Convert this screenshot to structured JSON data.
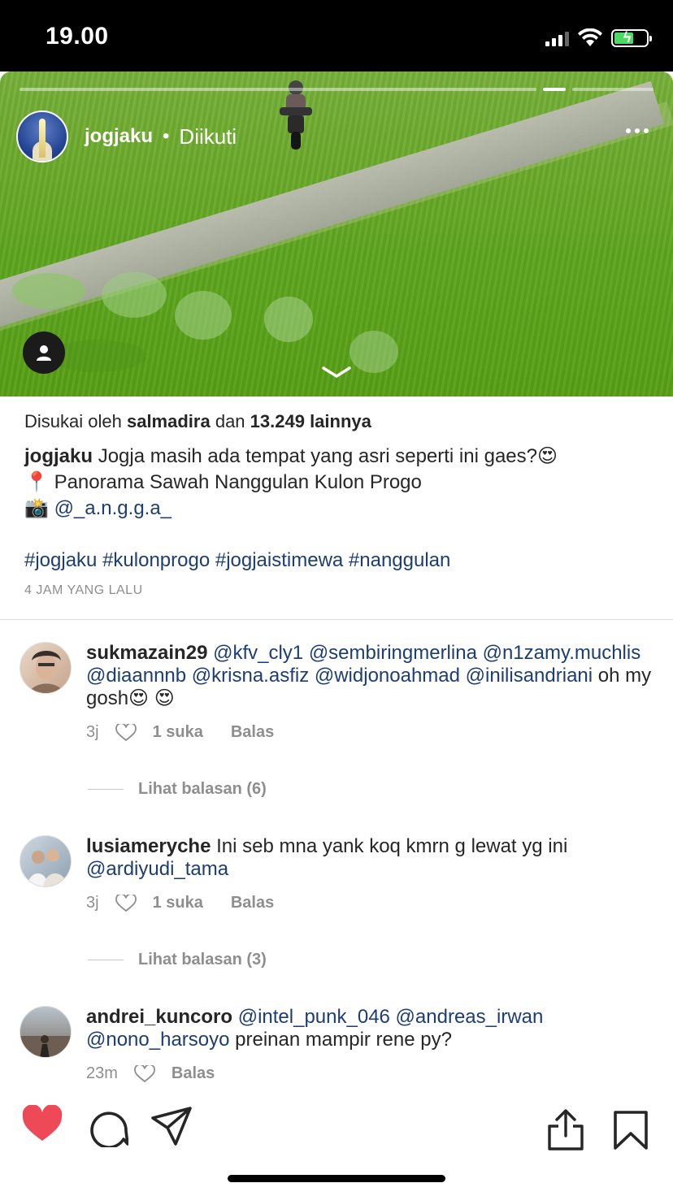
{
  "status_bar": {
    "time": "19.00",
    "signal_icon": "signal-bars-icon",
    "wifi_icon": "wifi-icon",
    "battery_icon": "battery-charging-icon",
    "battery_color": "#4cd964"
  },
  "post": {
    "username": "jogjaku",
    "separator": "•",
    "follow_status": "Diikuti",
    "more_icon": "more-dots-icon",
    "tag_icon": "person-tag-icon",
    "collapse_icon": "chevron-down-icon"
  },
  "likes": {
    "prefix": "Disukai oleh",
    "user": "salmadira",
    "connector": "dan",
    "count": "13.249 lainnya"
  },
  "caption": {
    "username": "jogjaku",
    "line1": "Jogja masih ada tempat yang asri seperti ini gaes?",
    "line1_emoji": "😍",
    "pin_emoji": "📍",
    "line2": "Panorama Sawah Nanggulan Kulon Progo",
    "camera_emoji": "📸",
    "line3_mention": "@_a.n.g.g.a_",
    "hashtags": "#jogjaku #kulonprogo #jogjaistimewa #nanggulan",
    "time_ago": "4 JAM YANG LALU"
  },
  "comments": [
    {
      "username": "sukmazain29",
      "mentions_a": "@kfv_cly1 @sembiringmerlina @n1zamy.muchlis @diaannnb @krisna.asfiz @widjonoahmad @inilisandriani",
      "text": "oh my gosh",
      "emoji": "😍 😍",
      "time": "3j",
      "likes": "1 suka",
      "reply": "Balas",
      "view_replies": "Lihat balasan (6)"
    },
    {
      "username": "lusiameryche",
      "text": "Ini seb mna yank koq kmrn g lewat yg ini",
      "mention": "@ardiyudi_tama",
      "time": "3j",
      "likes": "1 suka",
      "reply": "Balas",
      "view_replies": "Lihat balasan (3)"
    },
    {
      "username": "andrei_kuncoro",
      "mentions_a": "@intel_punk_046 @andreas_irwan",
      "mention_b": "@nono_harsoyo",
      "text": "preinan mampir rene py?",
      "time": "23m",
      "reply": "Balas"
    }
  ],
  "actions": {
    "like_icon": "heart-filled-icon",
    "like_color": "#ed4956",
    "comment_icon": "comment-bubble-icon",
    "share_icon": "send-paper-plane-icon",
    "upload_icon": "share-upload-icon",
    "save_icon": "bookmark-icon"
  }
}
